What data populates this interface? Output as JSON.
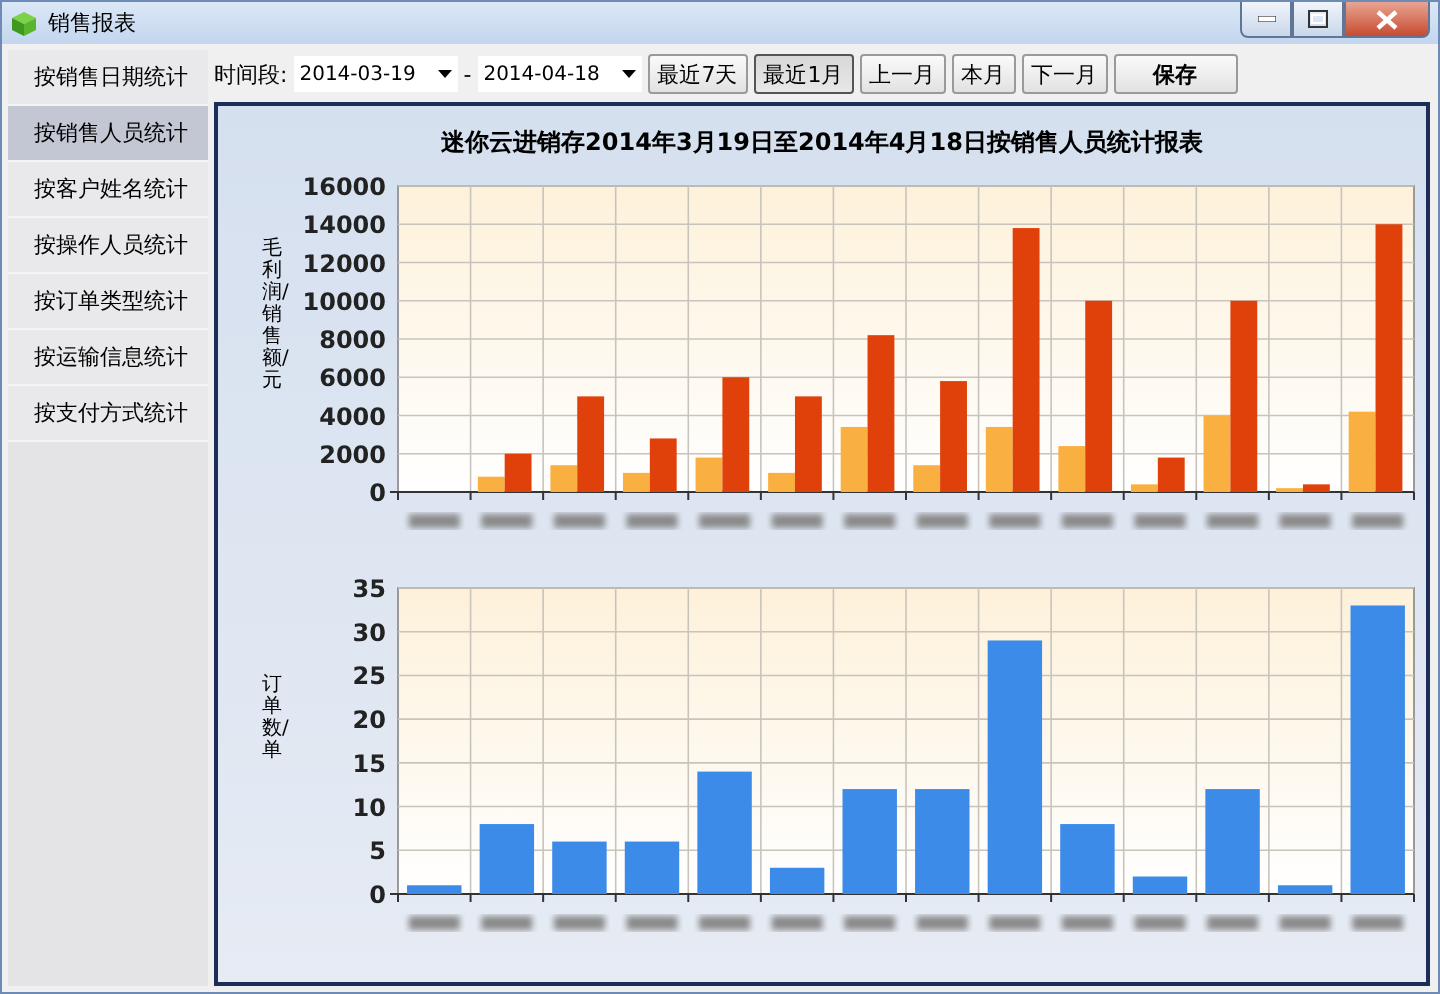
{
  "window": {
    "title": "销售报表"
  },
  "sidebar": {
    "items": [
      {
        "label": "按销售日期统计",
        "selected": false
      },
      {
        "label": "按销售人员统计",
        "selected": true
      },
      {
        "label": "按客户姓名统计",
        "selected": false
      },
      {
        "label": "按操作人员统计",
        "selected": false
      },
      {
        "label": "按订单类型统计",
        "selected": false
      },
      {
        "label": "按运输信息统计",
        "selected": false
      },
      {
        "label": "按支付方式统计",
        "selected": false
      }
    ]
  },
  "toolbar": {
    "label": "时间段:",
    "start_date": "2014-03-19",
    "separator": "-",
    "end_date": "2014-04-18",
    "range_buttons": [
      {
        "label": "最近7天",
        "selected": false
      },
      {
        "label": "最近1月",
        "selected": true
      },
      {
        "label": "上一月",
        "selected": false
      },
      {
        "label": "本月",
        "selected": false
      },
      {
        "label": "下一月",
        "selected": false
      }
    ],
    "save_button": "保存"
  },
  "report": {
    "title": "迷你云进销存2014年3月19日至2014年4月18日按销售人员统计报表",
    "charts": [
      {
        "chart_data": {
          "type": "bar",
          "ylabel": "毛利润/销售额/元",
          "grid": true,
          "ylim": [
            0,
            16000
          ],
          "yticks": [
            0,
            2000,
            4000,
            6000,
            8000,
            10000,
            12000,
            14000,
            16000
          ],
          "series": [
            {
              "color": "#f9b040",
              "values": [
                0,
                800,
                1400,
                1000,
                1800,
                1000,
                3400,
                1400,
                3400,
                2400,
                400,
                4000,
                200,
                4200
              ]
            },
            {
              "color": "#e0400a",
              "values": [
                0,
                2000,
                5000,
                2800,
                6000,
                5000,
                8200,
                5800,
                13800,
                10000,
                1800,
                10000,
                400,
                14000
              ]
            }
          ]
        }
      },
      {
        "chart_data": {
          "type": "bar",
          "ylabel": "订单数/单",
          "grid": true,
          "ylim": [
            0,
            35
          ],
          "yticks": [
            0,
            5,
            10,
            15,
            20,
            25,
            30,
            35
          ],
          "series": [
            {
              "color": "#3d8be8",
              "values": [
                1,
                8,
                6,
                6,
                14,
                3,
                12,
                12,
                29,
                8,
                2,
                12,
                1,
                33
              ]
            }
          ]
        }
      }
    ]
  }
}
